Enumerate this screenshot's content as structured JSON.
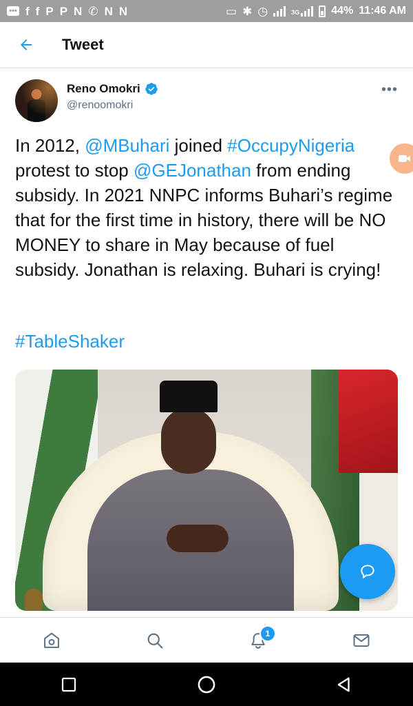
{
  "status_bar": {
    "left_icons": [
      "message-icon",
      "facebook-icon",
      "facebook-icon",
      "pinterest-icon",
      "pinterest-icon",
      "news-icon",
      "whatsapp-icon",
      "news-icon",
      "news-icon"
    ],
    "network": "3G",
    "battery": "44%",
    "time": "11:46 AM"
  },
  "header": {
    "title": "Tweet"
  },
  "tweet": {
    "author_name": "Reno Omokri",
    "handle": "@renoomokri",
    "more": "•••",
    "text_parts": [
      {
        "t": "In 2012, ",
        "link": false
      },
      {
        "t": "@MBuhari",
        "link": true
      },
      {
        "t": " joined ",
        "link": false
      },
      {
        "t": "#OccupyNigeria",
        "link": true
      },
      {
        "t": " protest to stop ",
        "link": false
      },
      {
        "t": "@GEJonathan",
        "link": true
      },
      {
        "t": " from ending subsidy. In 2021 NNPC informs Buhari’s regime that for the first time in history, there will be NO MONEY to share in May because of fuel subsidy. Jonathan is relaxing. Buhari is crying!",
        "link": false
      }
    ],
    "hashtag": "#TableShaker"
  },
  "bottom_nav": {
    "items": [
      "home-icon",
      "search-icon",
      "notifications-icon",
      "messages-icon"
    ],
    "notification_count": "1"
  },
  "colors": {
    "accent": "#1d9bf0",
    "text": "#0f1419",
    "secondary": "#5b7083",
    "status_bar": "#9e9e9e"
  }
}
